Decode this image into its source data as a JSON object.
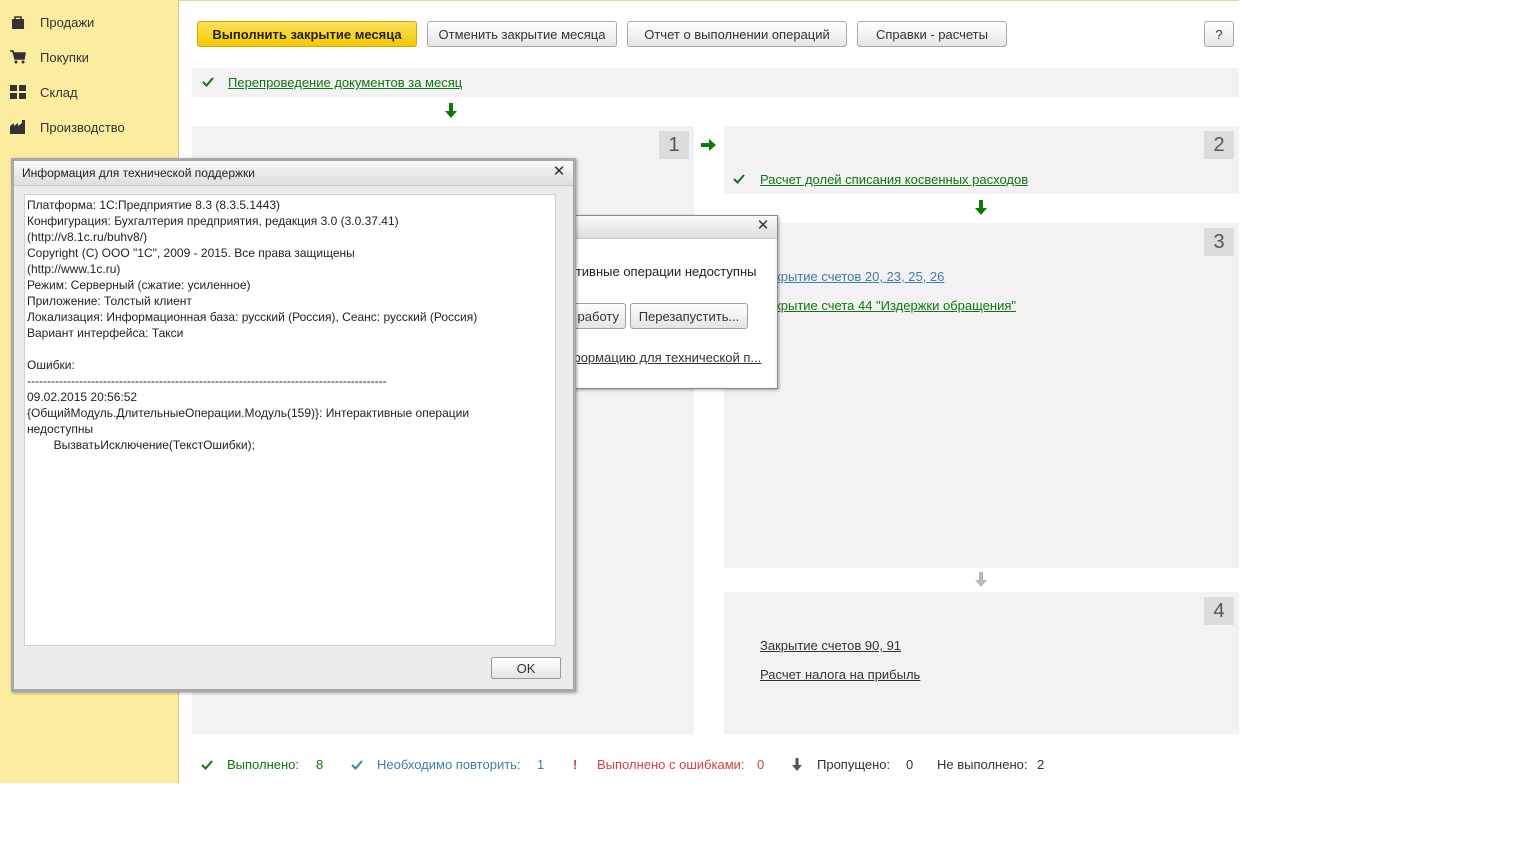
{
  "sidebar": {
    "items": [
      {
        "label": "Продажи",
        "icon": "bag-icon"
      },
      {
        "label": "Покупки",
        "icon": "cart-icon"
      },
      {
        "label": "Склад",
        "icon": "grid-icon"
      },
      {
        "label": "Производство",
        "icon": "factory-icon"
      }
    ]
  },
  "toolbar": {
    "close_month": "Выполнить закрытие месяца",
    "cancel_close": "Отменить закрытие месяца",
    "report": "Отчет о выполнении операций",
    "reference": "Справки - расчеты",
    "help": "?"
  },
  "steps": {
    "repost": "Перепроведение документов за месяц",
    "panel1_num": "1",
    "panel2_num": "2",
    "panel2_link": "Расчет долей списания косвенных расходов",
    "panel3_num": "3",
    "panel3_link1": "Закрытие счетов 20, 23, 25, 26",
    "panel3_link2": "Закрытие счета 44 \"Издержки обращения\"",
    "panel4_num": "4",
    "panel4_link1": "Закрытие счетов 90, 91",
    "panel4_link2": "Расчет налога на прибыль"
  },
  "status": {
    "done_label": "Выполнено:",
    "done_count": "8",
    "repeat_label": "Необходимо повторить:",
    "repeat_count": "1",
    "errors_label": "Выполнено с ошибками:",
    "errors_count": "0",
    "skipped_label": "Пропущено:",
    "skipped_count": "0",
    "notdone_label": "Не выполнено:",
    "notdone_count": "2"
  },
  "error_dialog": {
    "message": "ктивные операции недоступны",
    "btn_exit": "ь работу",
    "btn_restart": "Перезапустить...",
    "info_link": "формацию для технической п..."
  },
  "info_dialog": {
    "title": "Информация для технической поддержки",
    "text": "Платформа: 1С:Предприятие 8.3 (8.3.5.1443)\nКонфигурация: Бухгалтерия предприятия, редакция 3.0 (3.0.37.41)\n(http://v8.1c.ru/buhv8/)\nCopyright (C) ООО \"1С\", 2009 - 2015. Все права защищены\n(http://www.1c.ru)\nРежим: Серверный (сжатие: усиленное)\nПриложение: Толстый клиент\nЛокализация: Информационная база: русский (Россия), Сеанс: русский (Россия)\nВариант интерфейса: Такси\n\nОшибки:\n------------------------------------------------------------------------------------------\n09.02.2015 20:56:52\n{ОбщийМодуль.ДлительныеОперации.Модуль(159)}: Интерактивные операции\nнедоступны\n        ВызватьИсключение(ТекстОшибки);",
    "ok": "OK"
  },
  "colors": {
    "sidebar_bg": "#fbeca0",
    "accent_yellow": "#f5c800",
    "link_green": "#0a7a0a",
    "link_blue": "#3c7fa8",
    "error_red": "#d44040"
  }
}
